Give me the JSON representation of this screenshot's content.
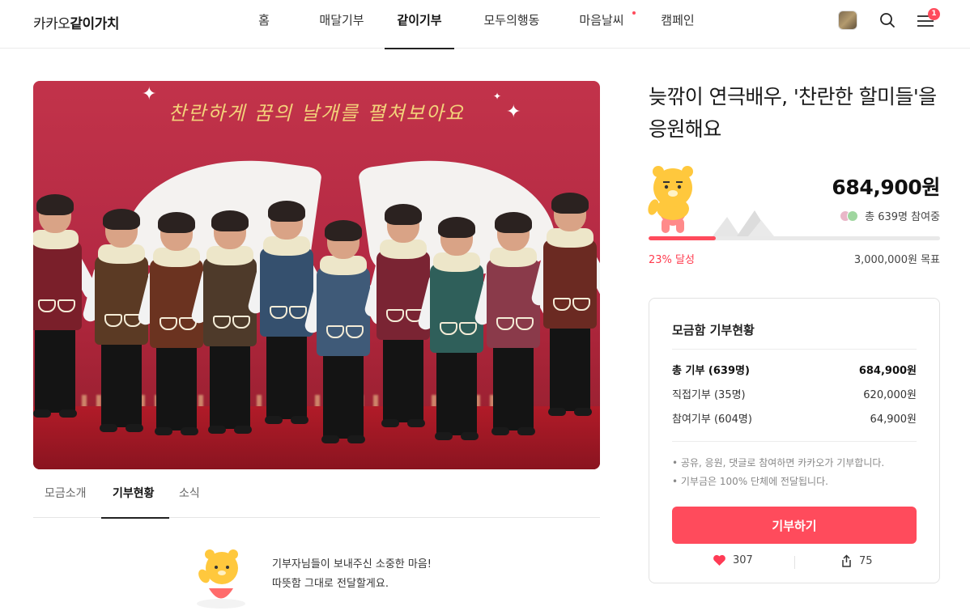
{
  "header": {
    "logo_light": "카카오",
    "logo_bold": "같이가치",
    "nav": [
      {
        "label": "홈"
      },
      {
        "label": "매달기부"
      },
      {
        "label": "같이기부"
      },
      {
        "label": "모두의행동"
      },
      {
        "label": "마음날씨"
      },
      {
        "label": "캠페인"
      }
    ],
    "active_nav": "같이기부",
    "notification_count": "1",
    "icons": [
      "avatar",
      "search-icon",
      "menu-icon"
    ]
  },
  "photo": {
    "banner_text": "찬란하게 꿈의 날개를 펼쳐보아요"
  },
  "tabs": [
    {
      "label": "모금소개"
    },
    {
      "label": "기부현황"
    },
    {
      "label": "소식"
    }
  ],
  "active_tab": "기부현황",
  "thanks": {
    "line1": "기부자님들이 보내주신 소중한 마음!",
    "line2": "따뜻함 그대로 전달할게요."
  },
  "campaign": {
    "title": "늦깎이 연극배우, '찬란한 할미들'을 응원해요",
    "amount": "684,900원",
    "participants": "총 639명 참여중",
    "progress": 0.23,
    "percent_label": "23% 달성",
    "goal": "3,000,000원 목표"
  },
  "status_card": {
    "title": "모금함 기부현황",
    "rows": [
      {
        "label": "총 기부 (639명)",
        "value": "684,900원"
      },
      {
        "label": "직접기부 (35명)",
        "value": "620,000원"
      },
      {
        "label": "참여기부 (604명)",
        "value": "64,900원"
      }
    ],
    "notes": [
      "• 공유, 응원, 댓글로 참여하면 카카오가 기부합니다.",
      "• 기부금은 100% 단체에 전달됩니다."
    ],
    "donate_label": "기부하기",
    "likes": "307",
    "shares": "75"
  },
  "colors": {
    "accent": "#ff4b5c",
    "banner_bg": "#b52a44"
  }
}
